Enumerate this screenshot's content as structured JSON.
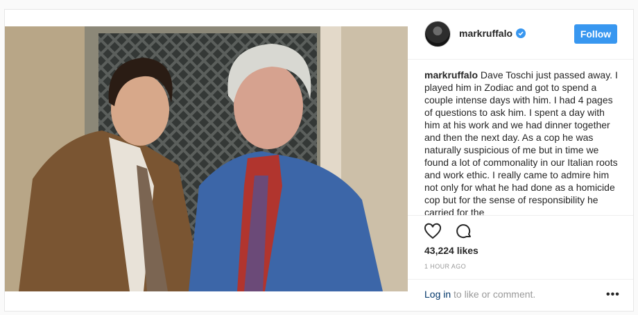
{
  "post": {
    "username": "markruffalo",
    "follow_label": "Follow",
    "caption_username": "markruffalo",
    "caption_text": "Dave Toschi just passed away. I played him in Zodiac and got to spend a couple intense days with him. I had 4 pages of questions to ask him. I spent a day with him at his work and we had dinner together and then the next day. As a cop he was naturally suspicious of me but in time we found a lot of commonality in our Italian roots and work ethic. I really came to admire him not only for what he had done as a homicide cop but for the sense of responsibility he carried for the",
    "likes": "43,224 likes",
    "time": "1 HOUR AGO",
    "login_link": "Log in",
    "login_rest": " to like or comment.",
    "more": "•••"
  },
  "icons": {
    "verified": "verified-badge-icon",
    "heart": "heart-icon",
    "comment": "comment-icon",
    "more": "more-options-icon"
  },
  "colors": {
    "follow_button": "#3897f0",
    "verified": "#3897f0",
    "link": "#003569"
  }
}
